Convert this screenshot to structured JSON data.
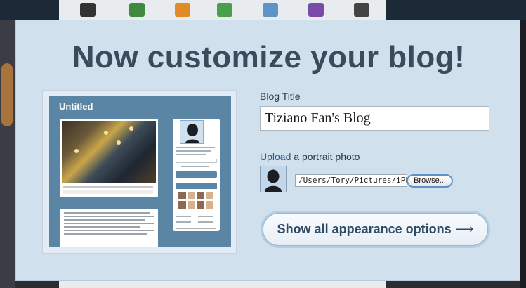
{
  "modal": {
    "heading": "Now customize your blog!"
  },
  "preview": {
    "blog_title": "Untitled"
  },
  "form": {
    "blog_title_label": "Blog Title",
    "blog_title_value": "Tiziano Fan's Blog",
    "upload_label_link": "Upload",
    "upload_label_rest": " a portrait photo",
    "file_path": "/Users/Tory/Pictures/iPhoto",
    "browse_label": "Browse..."
  },
  "actions": {
    "show_appearance_label": "Show all appearance options",
    "arrow_icon": "right-arrow-icon"
  },
  "colors": {
    "modal_bg": "#d0e0ed",
    "heading": "#3a4b5c",
    "preview_theme": "#5b85a5"
  }
}
